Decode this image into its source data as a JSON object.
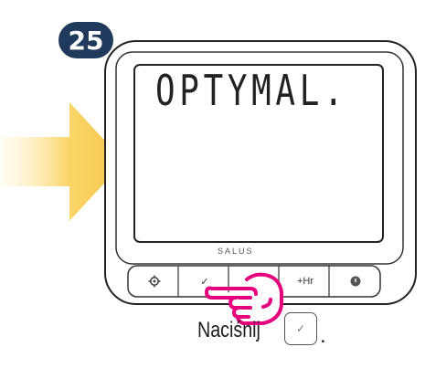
{
  "step": {
    "number": "25"
  },
  "display": {
    "text": "OPTYMAL."
  },
  "brand": {
    "logo": "SALUS"
  },
  "buttons": [
    {
      "label": "",
      "icon": "gear-icon"
    },
    {
      "label": "✓",
      "icon": "check-icon"
    },
    {
      "label": "∧",
      "icon": "up-icon"
    },
    {
      "label": "+Hr",
      "icon": ""
    },
    {
      "label": "",
      "icon": "power-icon"
    }
  ],
  "instruction": {
    "text": "Naciśnij",
    "key_symbol": "✓",
    "suffix": "."
  },
  "colors": {
    "arrow": "#f6c44a",
    "hand": "#e6007e",
    "badge": "#1f3a5c"
  }
}
